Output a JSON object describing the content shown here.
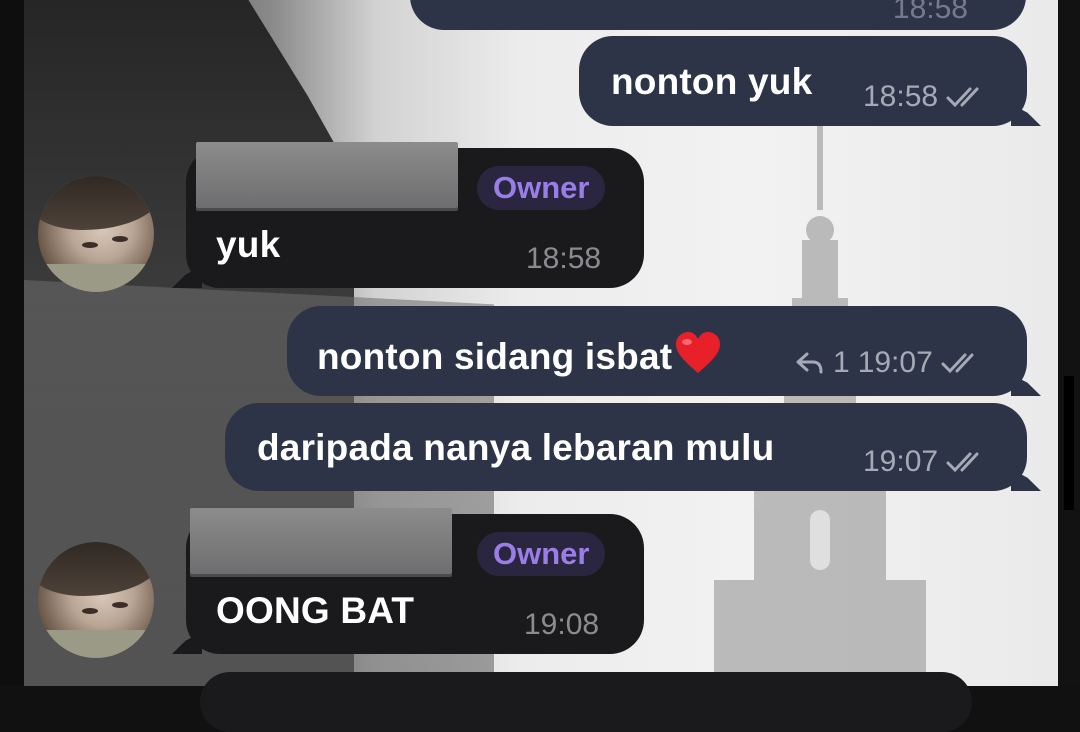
{
  "colors": {
    "outgoing_bubble": "#2e3448",
    "incoming_bubble": "#1a1a1d",
    "owner_badge_text": "#9a7ee8",
    "owner_badge_bg": "#2b2640"
  },
  "messages": [
    {
      "text": "nonton yuk",
      "time": "18:58",
      "status_icon": "double-check-icon"
    },
    {
      "sender_badge": "Owner",
      "text": "yuk",
      "time": "18:58"
    },
    {
      "text": "nonton sidang isbat",
      "emoji_icon": "red-heart-icon",
      "reply_icon": "reply-arrow-icon",
      "reply_count": "1",
      "time": "19:07",
      "status_icon": "double-check-icon"
    },
    {
      "text": "daripada nanya lebaran mulu",
      "time": "19:07",
      "status_icon": "double-check-icon"
    },
    {
      "sender_badge": "Owner",
      "text": "OONG BAT",
      "time": "19:08"
    }
  ],
  "top_partial": {
    "time": "18:58"
  }
}
